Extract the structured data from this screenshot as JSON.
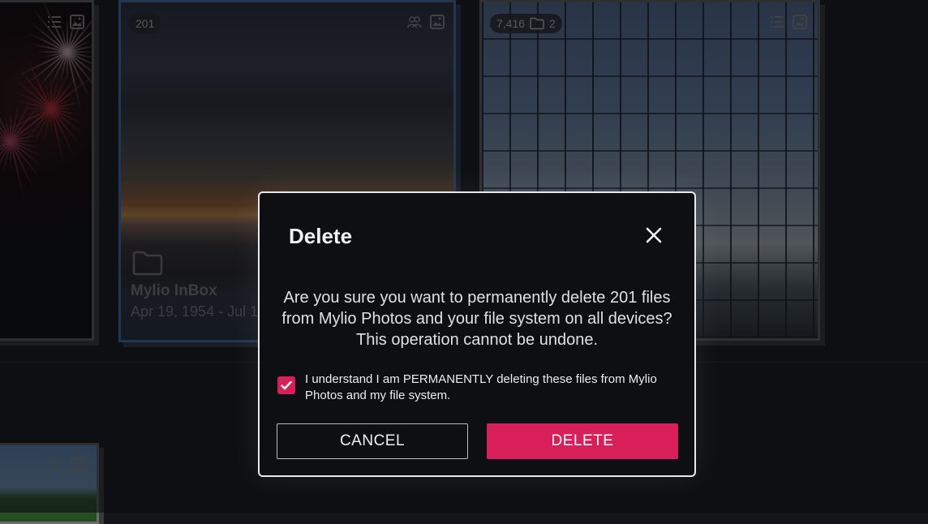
{
  "grid": {
    "tiles": [
      {
        "id": "fireworks"
      },
      {
        "id": "sunset",
        "count_badge": "201",
        "folder_name": "Mylio InBox",
        "date_range": "Apr 19, 1954 - Jul 1"
      },
      {
        "id": "glass",
        "count_badge": "7,416",
        "folder_count": "2"
      },
      {
        "id": "bottom"
      }
    ]
  },
  "dialog": {
    "title": "Delete",
    "message": "Are you sure you want to permanently delete 201 files from Mylio Photos and your file system on all devices? This operation cannot be undone.",
    "confirm_text": "I understand I am PERMANENTLY deleting these files from Mylio Photos and my file system.",
    "confirm_checked": true,
    "cancel_label": "CANCEL",
    "delete_label": "DELETE",
    "accent_color": "#d81f5a"
  }
}
